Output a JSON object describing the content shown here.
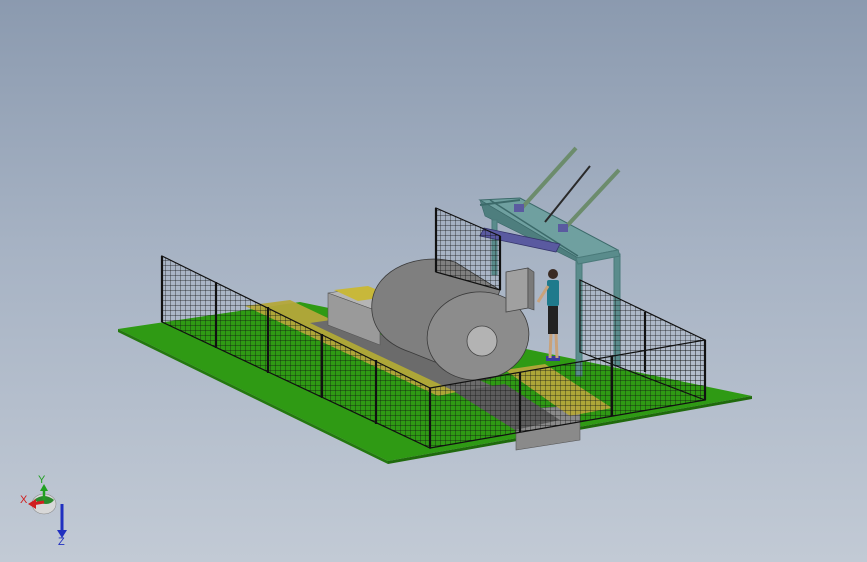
{
  "viewport": {
    "background_top": "#8b9aaf",
    "background_bottom": "#c2cad5"
  },
  "scene": {
    "objects": [
      "ground-platform",
      "safety-fence",
      "steel-coil",
      "coil-saddle-base",
      "yellow-walkway",
      "control-cabinet",
      "operator-figure",
      "gantry-frame",
      "tilting-arms"
    ],
    "colors": {
      "ground": "#2f9a14",
      "fence": "#1a1a1a",
      "coil": "#8c8c8c",
      "walkway": "#b4a73a",
      "gantry": "#5a8c8c",
      "arm": "#6c8c6c",
      "clamp": "#5a5aa0"
    }
  },
  "triad": {
    "x_label": "X",
    "y_label": "Y",
    "z_label": "Z",
    "x_color": "#d02020",
    "y_color": "#20a020",
    "z_color": "#2030c0"
  }
}
